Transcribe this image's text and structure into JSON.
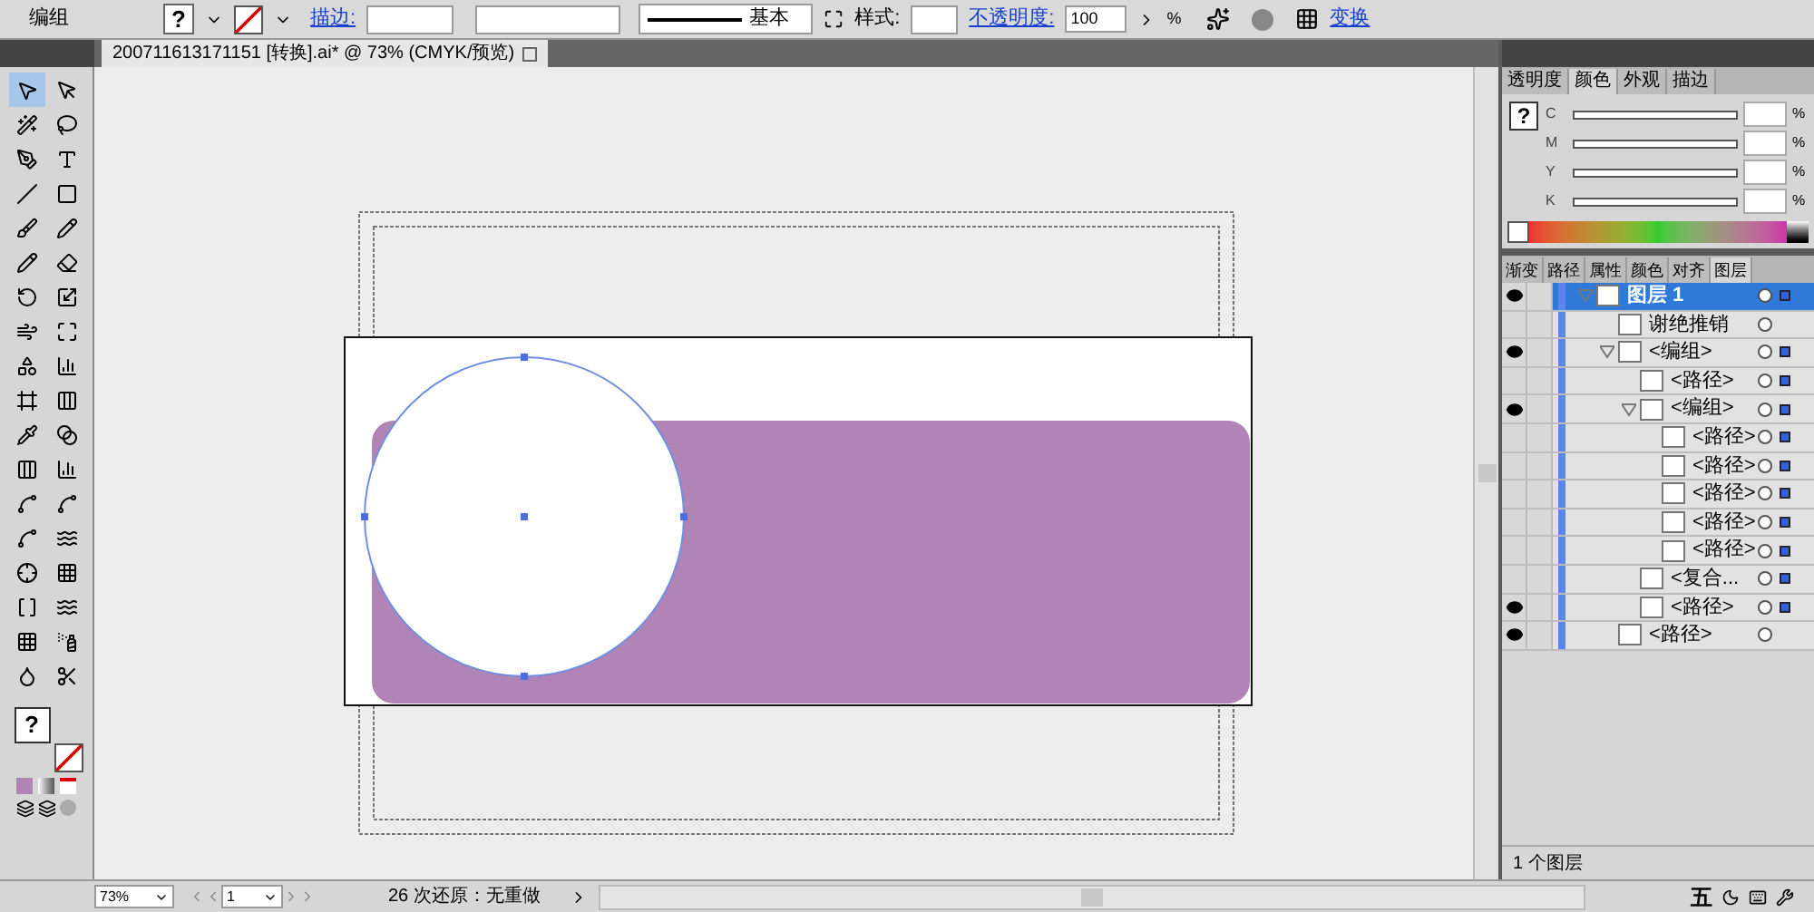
{
  "control_bar": {
    "selection_label": "编组",
    "fill_swatch": "?",
    "stroke_link": "描边:",
    "stroke_profile": "基本",
    "style_label": "样式:",
    "opacity_link": "不透明度:",
    "opacity_value": "100",
    "opacity_unit": "%",
    "transform_link": "变换"
  },
  "document_tab": {
    "title": "200711613171151  [转换].ai* @ 73% (CMYK/预览)"
  },
  "tools": [
    {
      "selected": true
    },
    {
      "selected": false
    },
    {
      "selected": false
    },
    {
      "selected": false
    },
    {
      "selected": false
    },
    {
      "selected": false
    },
    {
      "selected": false
    },
    {
      "selected": false
    },
    {
      "selected": false
    },
    {
      "selected": false
    },
    {
      "selected": false
    },
    {
      "selected": false
    },
    {
      "selected": false
    },
    {
      "selected": false
    },
    {
      "selected": false
    },
    {
      "selected": false
    },
    {
      "selected": false
    },
    {
      "selected": false
    },
    {
      "selected": false
    },
    {
      "selected": false
    },
    {
      "selected": false
    },
    {
      "selected": false
    },
    {
      "selected": false
    },
    {
      "selected": false
    },
    {
      "selected": false
    },
    {
      "selected": false
    },
    {
      "selected": false
    },
    {
      "selected": false
    },
    {
      "selected": false
    },
    {
      "selected": false
    },
    {
      "selected": false
    },
    {
      "selected": false
    },
    {
      "selected": false
    },
    {
      "selected": false
    },
    {
      "selected": false
    },
    {
      "selected": false
    }
  ],
  "toolbox_fill_swatch": "?",
  "color_panel": {
    "tabs": [
      {
        "label": "透明度",
        "selected": false
      },
      {
        "label": "颜色",
        "selected": true
      },
      {
        "label": "外观",
        "selected": false
      },
      {
        "label": "描边",
        "selected": false
      }
    ],
    "fill_swatch": "?",
    "channels": [
      {
        "label": "C",
        "unit": "%"
      },
      {
        "label": "M",
        "unit": "%"
      },
      {
        "label": "Y",
        "unit": "%"
      },
      {
        "label": "K",
        "unit": "%"
      }
    ]
  },
  "layers_panel": {
    "tabs": [
      {
        "label": "渐变",
        "selected": false
      },
      {
        "label": "路径",
        "selected": false
      },
      {
        "label": "属性",
        "selected": false
      },
      {
        "label": "颜色",
        "selected": false
      },
      {
        "label": "对齐",
        "selected": false
      },
      {
        "label": "图层",
        "selected": true
      }
    ],
    "layers": [
      {
        "name": "图层 1",
        "visible": true,
        "expanded": true,
        "selected": true,
        "has_selection": true,
        "children": [
          {
            "name": "谢绝推销",
            "visible": false,
            "selected": false,
            "has_selection": false
          },
          {
            "name": "<编组>",
            "visible": true,
            "expanded": true,
            "selected": false,
            "has_selection": true,
            "children": [
              {
                "name": "<路径>",
                "visible": false,
                "selected": false,
                "has_selection": true
              },
              {
                "name": "<编组>",
                "visible": true,
                "expanded": true,
                "selected": false,
                "has_selection": true,
                "children": [
                  {
                    "name": "<路径>",
                    "visible": false,
                    "selected": false,
                    "has_selection": true
                  },
                  {
                    "name": "<路径>",
                    "visible": false,
                    "selected": false,
                    "has_selection": true
                  },
                  {
                    "name": "<路径>",
                    "visible": false,
                    "selected": false,
                    "has_selection": true
                  },
                  {
                    "name": "<路径>",
                    "visible": false,
                    "selected": false,
                    "has_selection": true
                  },
                  {
                    "name": "<路径>",
                    "visible": false,
                    "selected": false,
                    "has_selection": true
                  }
                ]
              },
              {
                "name": "<复合...",
                "visible": false,
                "selected": false,
                "has_selection": true
              },
              {
                "name": "<路径>",
                "visible": true,
                "selected": false,
                "has_selection": true
              }
            ]
          },
          {
            "name": "<路径>",
            "visible": true,
            "selected": false,
            "has_selection": false
          }
        ]
      }
    ],
    "footer": "1 个图层"
  },
  "status_bar": {
    "zoom": "73%",
    "artboard": "1",
    "history": "26 次还原：无重做"
  },
  "ime_bar": {
    "mode": "五"
  }
}
